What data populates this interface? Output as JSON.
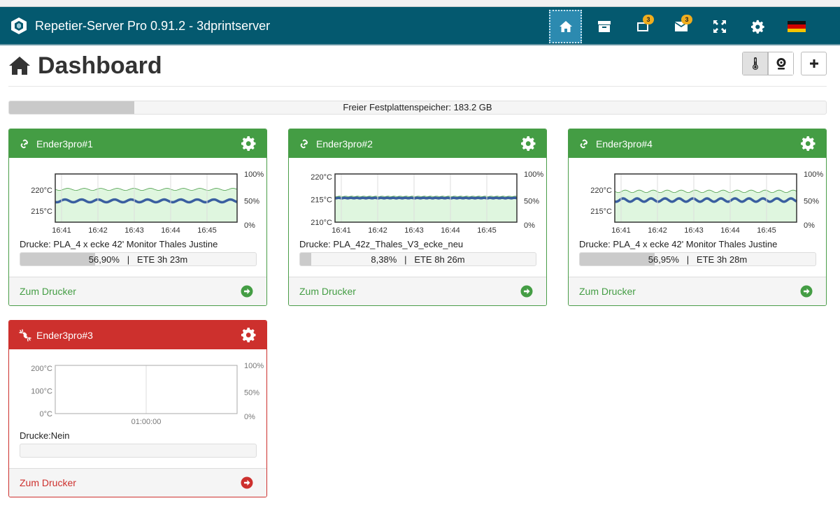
{
  "app": {
    "title": "Repetier-Server Pro 0.91.2 - 3dprintserver",
    "colors": {
      "navbar": "#04596f",
      "online": "#449d44",
      "offline": "#cd302d",
      "accent": "#2c8ab0"
    }
  },
  "nav": {
    "icons": [
      "home-icon",
      "archive-icon",
      "tablet-icon",
      "envelope-icon",
      "expand-icon",
      "gear-icon",
      "german-flag-icon"
    ],
    "tablet_badge": "3",
    "mail_badge": "3"
  },
  "header": {
    "title": "Dashboard"
  },
  "disk": {
    "label": "Freier Festplattenspeicher: 183.2 GB",
    "used_fraction": 0.153
  },
  "cards": [
    {
      "name": "Ender3pro#1",
      "status": "online",
      "job": "Drucke: PLA_4 x ecke 42' Monitor Thales Justine",
      "progress_pct": 56.9,
      "progress_label": "56,90%",
      "sep": "|",
      "ete_label": "ETE 3h 23m",
      "footer": "Zum Drucker",
      "chart": {
        "temp_labels": [
          "220°C",
          "215°C"
        ],
        "pct_labels": [
          "100%",
          "50%",
          "0%"
        ],
        "time_labels": [
          "16:41",
          "16:42",
          "16:43",
          "16:44",
          "16:45"
        ],
        "ymin": 212,
        "ymax": 224,
        "target": 220,
        "temp_center": 217.3,
        "temp_amp": 0.5,
        "waves": 11
      }
    },
    {
      "name": "Ender3pro#2",
      "status": "online",
      "job": "Drucke: PLA_42z_Thales_V3_ecke_neu",
      "progress_pct": 8.38,
      "progress_label": "8,38%",
      "sep": "|",
      "ete_label": "ETE 8h 26m",
      "footer": "Zum Drucker",
      "chart": {
        "temp_labels": [
          "220°C",
          "215°C",
          "210°C"
        ],
        "pct_labels": [
          "100%",
          "50%",
          "0%"
        ],
        "time_labels": [
          "16:41",
          "16:42",
          "16:43",
          "16:44",
          "16:45"
        ],
        "ymin": 210,
        "ymax": 220,
        "target": 215.2,
        "temp_center": 215.0,
        "temp_amp": 0.1,
        "waves": 30
      }
    },
    {
      "name": "Ender3pro#4",
      "status": "online",
      "job": "Drucke: PLA_4 x ecke 42' Monitor Thales Justine",
      "progress_pct": 56.95,
      "progress_label": "56,95%",
      "sep": "|",
      "ete_label": "ETE 3h 28m",
      "footer": "Zum Drucker",
      "chart": {
        "temp_labels": [
          "220°C",
          "215°C"
        ],
        "pct_labels": [
          "100%",
          "50%",
          "0%"
        ],
        "time_labels": [
          "16:41",
          "16:42",
          "16:43",
          "16:44",
          "16:45"
        ],
        "ymin": 212,
        "ymax": 224,
        "target": 219.5,
        "temp_center": 217.5,
        "temp_amp": 0.6,
        "waves": 13
      }
    },
    {
      "name": "Ender3pro#3",
      "status": "offline",
      "job": "Drucke:Nein",
      "progress_pct": 0,
      "progress_label": "",
      "sep": "",
      "ete_label": "",
      "footer": "Zum Drucker",
      "chart": {
        "temp_labels": [
          "200°C",
          "100°C",
          "0°C"
        ],
        "pct_labels": [
          "100%",
          "50%",
          "0%"
        ],
        "time_labels": [
          "01:00:00"
        ],
        "ymin": 0,
        "ymax": 250,
        "target": null,
        "temp_center": null,
        "temp_amp": 0,
        "waves": 0
      }
    }
  ]
}
